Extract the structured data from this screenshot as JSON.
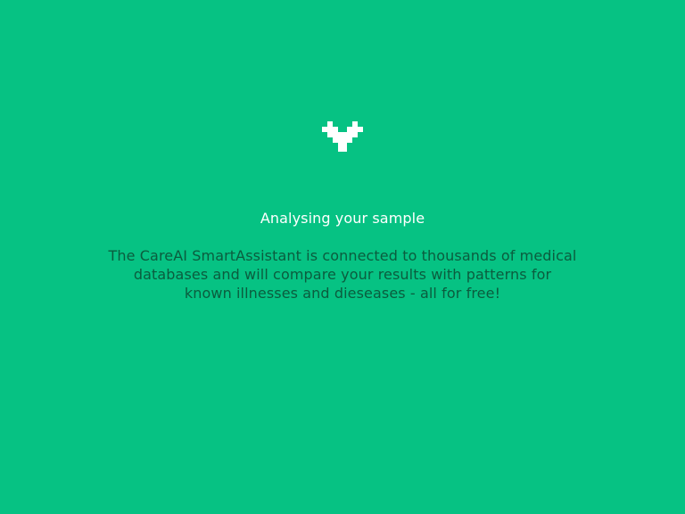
{
  "screen": {
    "logo_icon": "pixel-heart-icon",
    "title": "Analysing your sample",
    "description_line1": "The CareAI SmartAssistant is connected to thousands of medical",
    "description_line2": "databases and will compare your results with patterns for",
    "description_line3": "known illnesses and dieseases - all for free!"
  },
  "colors": {
    "background": "#06c283",
    "title_text": "#ffffff",
    "body_text": "#0b5c3e",
    "logo": "#ffffff"
  }
}
